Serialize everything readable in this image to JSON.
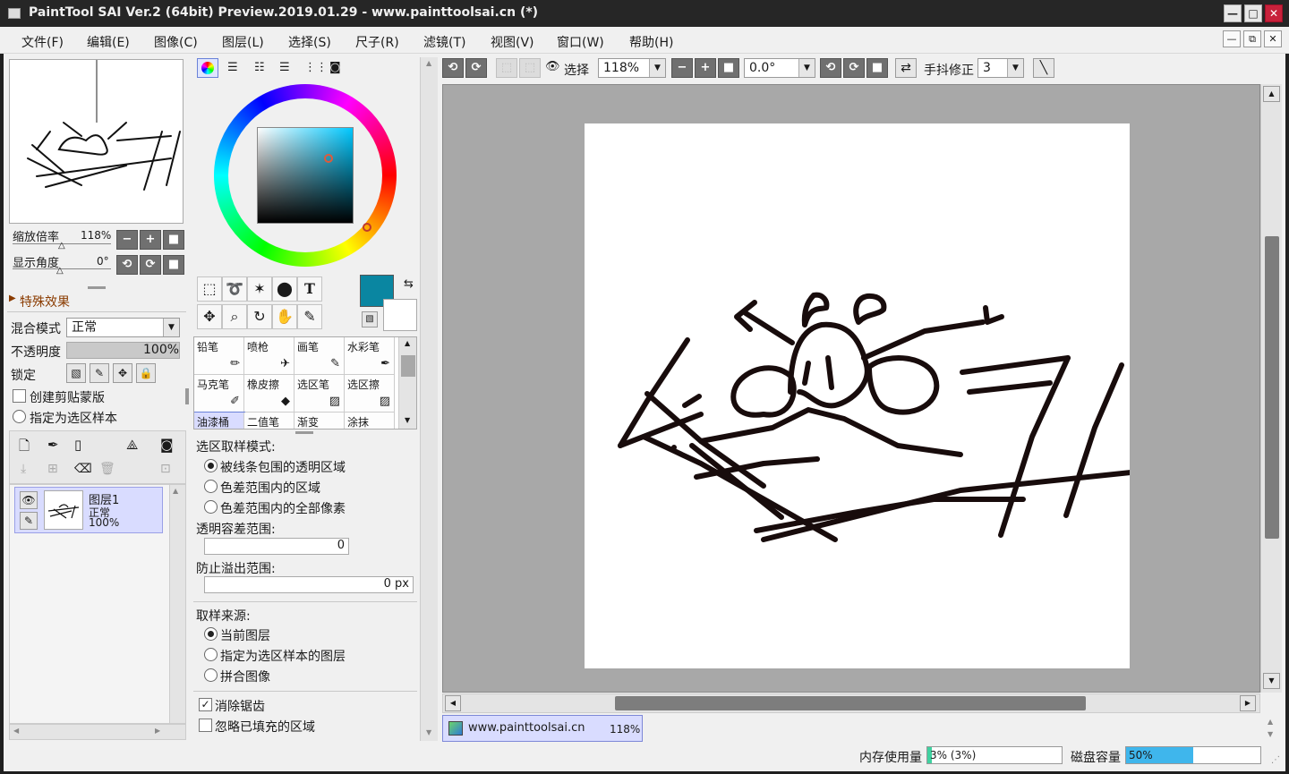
{
  "window": {
    "title": "PaintTool SAI Ver.2 (64bit) Preview.2019.01.29 - www.painttoolsai.cn (*)",
    "min_glyph": "—",
    "max_glyph": "□",
    "close_glyph": "✕"
  },
  "menu": {
    "items": [
      "文件(F)",
      "编辑(E)",
      "图像(C)",
      "图层(L)",
      "选择(S)",
      "尺子(R)",
      "滤镜(T)",
      "视图(V)",
      "窗口(W)",
      "帮助(H)"
    ],
    "mdi_min": "—",
    "mdi_restore": "⧉",
    "mdi_close": "✕"
  },
  "navigator": {
    "zoom_label": "缩放倍率",
    "zoom_value": "118%",
    "angle_label": "显示角度",
    "angle_value": "0°"
  },
  "layer_panel": {
    "effects_label": "特殊效果",
    "blend_label": "混合模式",
    "blend_value": "正常",
    "opacity_label": "不透明度",
    "opacity_value": "100%",
    "lock_label": "锁定",
    "clip_label": "创建剪贴蒙版",
    "sample_label": "指定为选区样本",
    "layer": {
      "name": "图层1",
      "mode": "正常",
      "opacity": "100%"
    }
  },
  "tools": {
    "text_tool": "T",
    "brushes": [
      "铅笔",
      "喷枪",
      "画笔",
      "水彩笔",
      "马克笔",
      "橡皮擦",
      "选区笔",
      "选区擦",
      "油漆桶",
      "二值笔",
      "渐变",
      "涂抹"
    ],
    "selected_brush": "油漆桶",
    "primary_color": "#0a86a1",
    "secondary_color": "#ffffff"
  },
  "bucket_options": {
    "mode_label": "选区取样模式:",
    "mode_options": [
      "被线条包围的透明区域",
      "色差范围内的区域",
      "色差范围内的全部像素"
    ],
    "tolerance_label": "透明容差范围:",
    "tolerance_value": "0",
    "overflow_label": "防止溢出范围:",
    "overflow_value": "0 px",
    "source_label": "取样来源:",
    "source_options": [
      "当前图层",
      "指定为选区样本的图层",
      "拼合图像"
    ],
    "antialias_label": "消除锯齿",
    "ignore_label": "忽略已填充的区域"
  },
  "canvas_toolbar": {
    "select_label": "选择",
    "zoom_value": "118%",
    "angle_value": "0.0°",
    "stabilizer_label": "手抖修正",
    "stabilizer_value": "3"
  },
  "canvas_tab": {
    "name": "www.painttoolsai.cn",
    "zoom": "118%"
  },
  "status": {
    "memory_label": "内存使用量",
    "memory_value": "3% (3%)",
    "memory_fraction": 0.03,
    "disk_label": "磁盘容量",
    "disk_value": "50%",
    "disk_fraction": 0.5
  },
  "colors": {
    "accent_blue": "#3fb6ec",
    "memory_green": "#3fd1a0",
    "layer_selected": "#d9dcff"
  }
}
